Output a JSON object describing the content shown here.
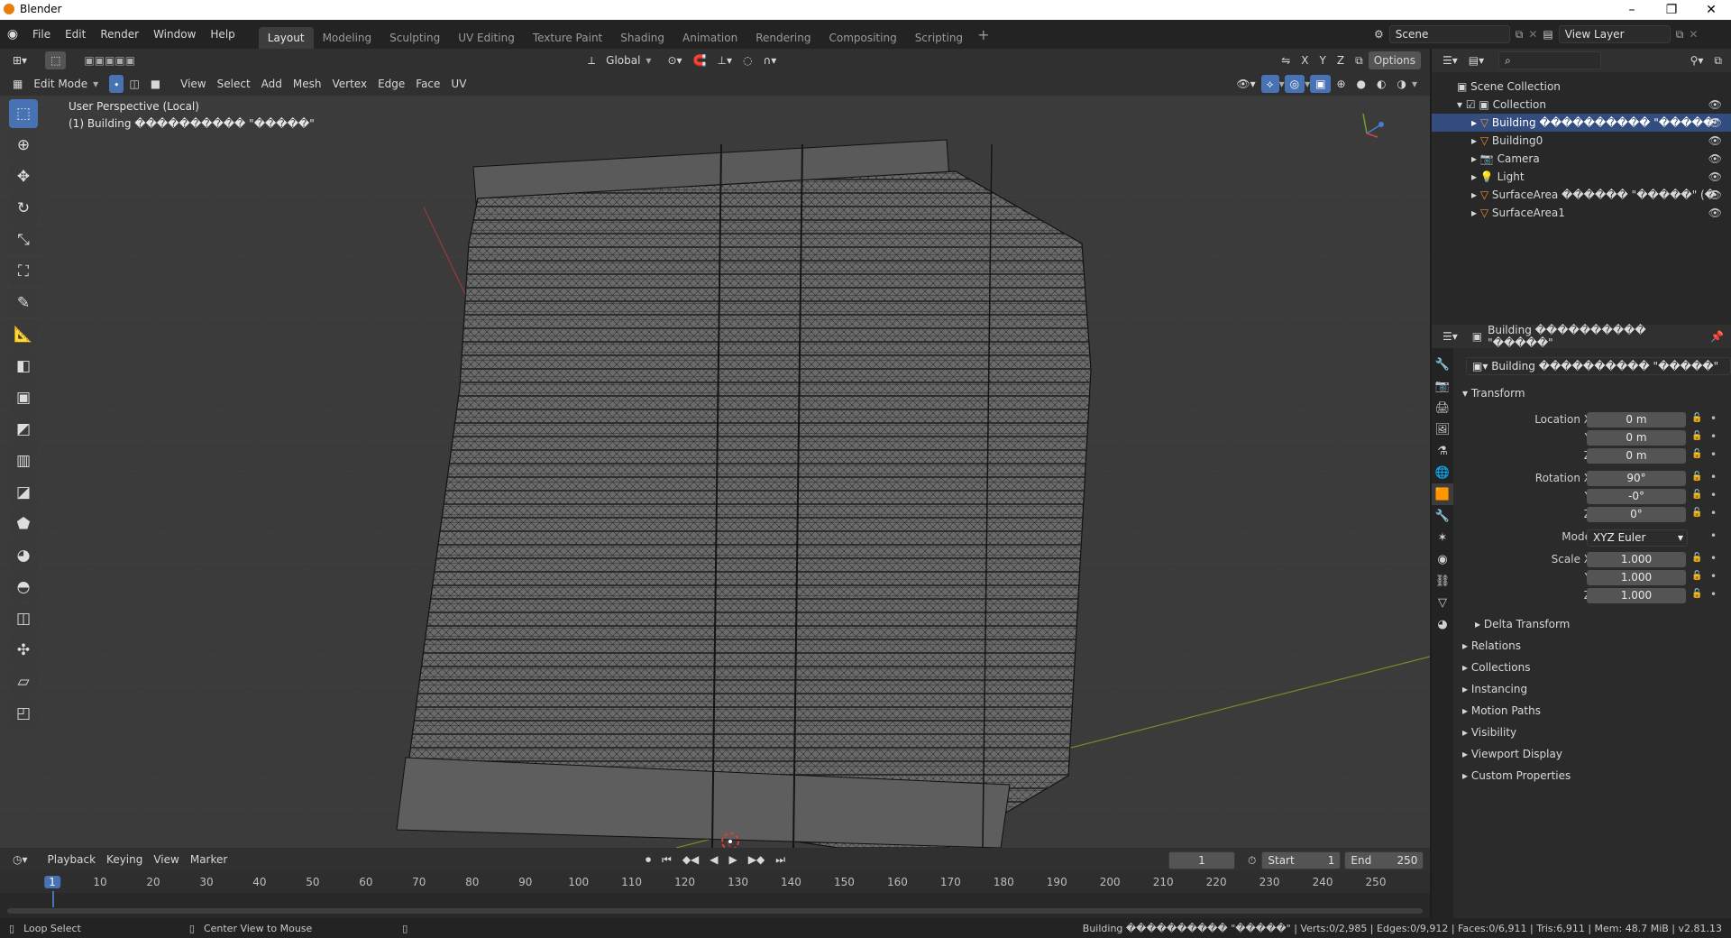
{
  "window": {
    "title": "Blender"
  },
  "menus": [
    "File",
    "Edit",
    "Render",
    "Window",
    "Help"
  ],
  "workspaces": [
    "Layout",
    "Modeling",
    "Sculpting",
    "UV Editing",
    "Texture Paint",
    "Shading",
    "Animation",
    "Rendering",
    "Compositing",
    "Scripting"
  ],
  "active_workspace": "Layout",
  "scene": {
    "label": "Scene",
    "view_layer": "View Layer"
  },
  "viewport": {
    "orientation": "Global",
    "options": "Options",
    "mode": "Edit Mode",
    "menu": [
      "View",
      "Select",
      "Add",
      "Mesh",
      "Vertex",
      "Edge",
      "Face",
      "UV"
    ],
    "axes": [
      "X",
      "Y",
      "Z"
    ],
    "perspective": "User Perspective (Local)",
    "object_info": "(1) Building ���������� \"�����\""
  },
  "outliner": {
    "root": "Scene Collection",
    "collection": "Collection",
    "items": [
      {
        "name": "Building ���������� \"�����\"",
        "selected": true
      },
      {
        "name": "Building0",
        "selected": false
      },
      {
        "name": "Camera",
        "selected": false
      },
      {
        "name": "Light",
        "selected": false
      },
      {
        "name": "SurfaceArea ������ \"�����\" (�",
        "selected": false
      },
      {
        "name": "SurfaceArea1",
        "selected": false
      }
    ]
  },
  "properties": {
    "object_name": "Building ���������� \"�����\"",
    "datablock": "Building ���������� \"�����\"",
    "transform_label": "Transform",
    "location": {
      "label": "Location X",
      "x": "0 m",
      "y": "0 m",
      "z": "0 m"
    },
    "rotation": {
      "label": "Rotation X",
      "x": "90°",
      "y": "-0°",
      "z": "0°"
    },
    "mode": {
      "label": "Mode",
      "value": "XYZ Euler"
    },
    "scale": {
      "label": "Scale X",
      "x": "1.000",
      "y": "1.000",
      "z": "1.000"
    },
    "axis_y": "Y",
    "axis_z": "Z",
    "delta": "Delta Transform",
    "sections": [
      "Relations",
      "Collections",
      "Instancing",
      "Motion Paths",
      "Visibility",
      "Viewport Display",
      "Custom Properties"
    ]
  },
  "timeline": {
    "menus": [
      "Playback",
      "Keying",
      "View",
      "Marker"
    ],
    "current_frame": "1",
    "start_label": "Start",
    "start": "1",
    "end_label": "End",
    "end": "250",
    "ticks": [
      "1",
      "10",
      "20",
      "30",
      "40",
      "50",
      "60",
      "70",
      "80",
      "90",
      "100",
      "110",
      "120",
      "130",
      "140",
      "150",
      "160",
      "170",
      "180",
      "190",
      "200",
      "210",
      "220",
      "230",
      "240",
      "250"
    ]
  },
  "status": {
    "left1": "Loop Select",
    "left2": "Center View to Mouse",
    "right": "Building ���������� \"�����\" | Verts:0/2,985 | Edges:0/9,912 | Faces:0/6,911 | Tris:6,911 | Mem: 48.7 MiB | v2.81.13"
  }
}
